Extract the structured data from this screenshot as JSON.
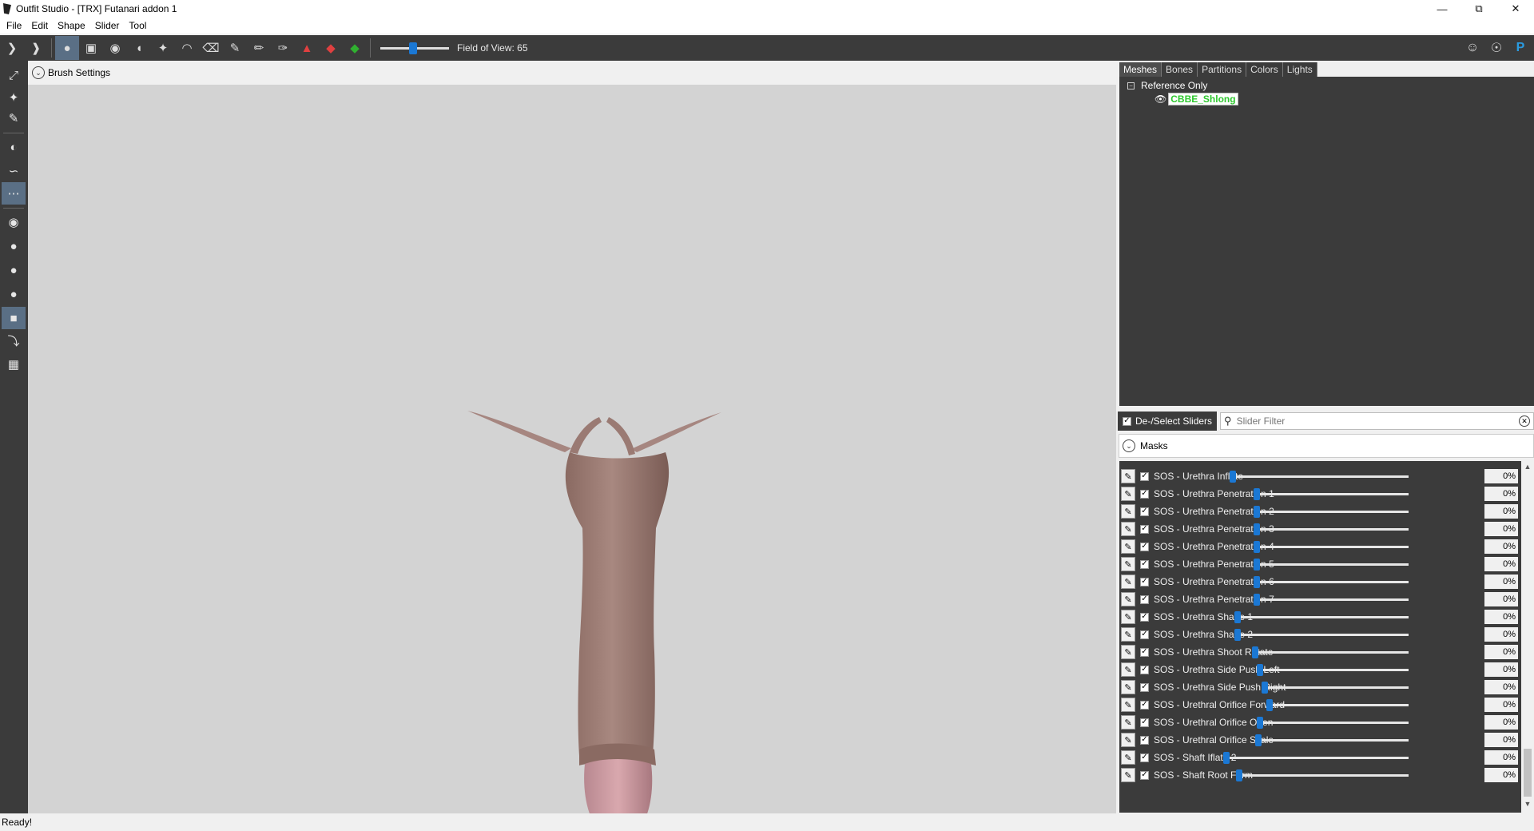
{
  "window": {
    "title": "Outfit Studio - [TRX] Futanari addon 1",
    "minimize": "—",
    "restore": "⧉",
    "close": "✕"
  },
  "menu": [
    "File",
    "Edit",
    "Shape",
    "Slider",
    "Tool"
  ],
  "toolbar": {
    "fov_label": "Field of View: 65",
    "fov_value": 0.4
  },
  "viewport": {
    "brush_settings_label": "Brush Settings",
    "background": "#d3d3d3"
  },
  "tabs": [
    "Meshes",
    "Bones",
    "Partitions",
    "Colors",
    "Lights"
  ],
  "mesh_tree": {
    "root_label": "Reference Only",
    "mesh_name": "CBBE_Shlong"
  },
  "slider_panel": {
    "deselect_label": "De-/Select Sliders",
    "filter_placeholder": "Slider Filter",
    "masks_label": "Masks"
  },
  "sliders": [
    {
      "name": "SOS - Urethra Inflate",
      "value": "0%"
    },
    {
      "name": "SOS - Urethra Penetration 1",
      "value": "0%"
    },
    {
      "name": "SOS - Urethra Penetration 2",
      "value": "0%"
    },
    {
      "name": "SOS - Urethra Penetration 3",
      "value": "0%"
    },
    {
      "name": "SOS - Urethra Penetration 4",
      "value": "0%"
    },
    {
      "name": "SOS - Urethra Penetration 5",
      "value": "0%"
    },
    {
      "name": "SOS - Urethra Penetration 6",
      "value": "0%"
    },
    {
      "name": "SOS - Urethra Penetration 7",
      "value": "0%"
    },
    {
      "name": "SOS - Urethra Shape 1",
      "value": "0%"
    },
    {
      "name": "SOS - Urethra Shape 2",
      "value": "0%"
    },
    {
      "name": "SOS - Urethra Shoot Rotate",
      "value": "0%"
    },
    {
      "name": "SOS - Urethra Side Push Left",
      "value": "0%"
    },
    {
      "name": "SOS - Urethra Side Push Right",
      "value": "0%"
    },
    {
      "name": "SOS - Urethral Orifice Forward",
      "value": "0%"
    },
    {
      "name": "SOS - Urethral Orifice Open",
      "value": "0%"
    },
    {
      "name": "SOS - Urethral Orifice Scale",
      "value": "0%"
    },
    {
      "name": "SOS - Shaft Iflate 2",
      "value": "0%"
    },
    {
      "name": "SOS - Shaft Root Form",
      "value": "0%"
    }
  ],
  "status": "Ready!",
  "colors": {
    "toolbar_bg": "#3b3b3b",
    "accent": "#1b78d4",
    "mesh_name_color": "#2ec82e"
  }
}
